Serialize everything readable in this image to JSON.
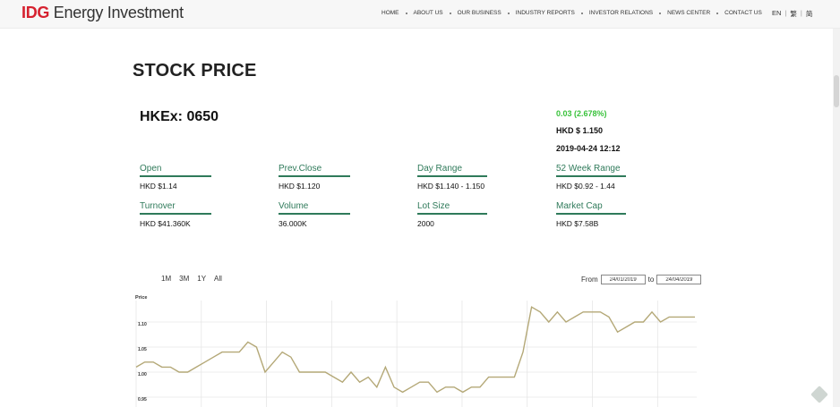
{
  "header": {
    "logo_brand": "IDG",
    "logo_rest": " Energy Investment",
    "nav": [
      "HOME",
      "ABOUT US",
      "OUR BUSINESS",
      "INDUSTRY REPORTS",
      "INVESTOR RELATIONS",
      "NEWS CENTER",
      "CONTACT US"
    ],
    "lang": [
      "EN",
      "|",
      "繁",
      "|",
      "简"
    ]
  },
  "page": {
    "title": "STOCK PRICE",
    "ticker": "HKEx: 0650"
  },
  "quote": {
    "change": "0.03 (2.678%)",
    "price": "HKD $ 1.150",
    "datetime": "2019-04-24 12:12"
  },
  "stats": {
    "open": {
      "label": "Open",
      "value": "HKD $1.14"
    },
    "prev_close": {
      "label": "Prev.Close",
      "value": "HKD $1.120"
    },
    "day_range": {
      "label": "Day Range",
      "value": "HKD $1.140 - 1.150"
    },
    "week52": {
      "label": "52 Week Range",
      "value": "HKD $0.92 - 1.44"
    },
    "turnover": {
      "label": "Turnover",
      "value": "HKD $41.360K"
    },
    "volume": {
      "label": "Volume",
      "value": "36.000K"
    },
    "lot_size": {
      "label": "Lot Size",
      "value": "2000"
    },
    "market_cap": {
      "label": "Market Cap",
      "value": "HKD $7.58B"
    }
  },
  "controls": {
    "ranges": [
      "1M",
      "3M",
      "1Y",
      "All"
    ],
    "from_label": "From",
    "from_value": "24/01/2019",
    "to_label": "to",
    "to_value": "24/04/2019"
  },
  "colors": {
    "accent_green": "#2f7a5a",
    "change_green": "#39c23b",
    "brand_red": "#d6212f",
    "line": "#b4a877"
  },
  "chart_data": {
    "type": "line",
    "ylabel": "Price",
    "y_ticks": [
      "1.10",
      "1.05",
      "1.00",
      "0.95"
    ],
    "ylim": [
      0.95,
      1.12
    ],
    "grid": true,
    "series": [
      {
        "values": [
          1.01,
          1.02,
          1.02,
          1.01,
          1.01,
          1.0,
          1.0,
          1.01,
          1.02,
          1.03,
          1.04,
          1.04,
          1.04,
          1.06,
          1.05,
          1.0,
          1.02,
          1.04,
          1.03,
          1.0,
          1.0,
          1.0,
          1.0,
          0.99,
          0.98,
          1.0,
          0.98,
          0.99,
          0.97,
          1.01,
          0.97,
          0.96,
          0.97,
          0.98,
          0.98,
          0.96,
          0.97,
          0.97,
          0.96,
          0.97,
          0.97,
          0.99,
          0.99,
          0.99,
          0.99,
          1.04,
          1.13,
          1.12,
          1.1,
          1.12,
          1.1,
          1.11,
          1.12,
          1.12,
          1.12,
          1.11,
          1.08,
          1.09,
          1.1,
          1.1,
          1.12,
          1.1,
          1.11,
          1.11,
          1.11,
          1.11
        ]
      }
    ]
  }
}
